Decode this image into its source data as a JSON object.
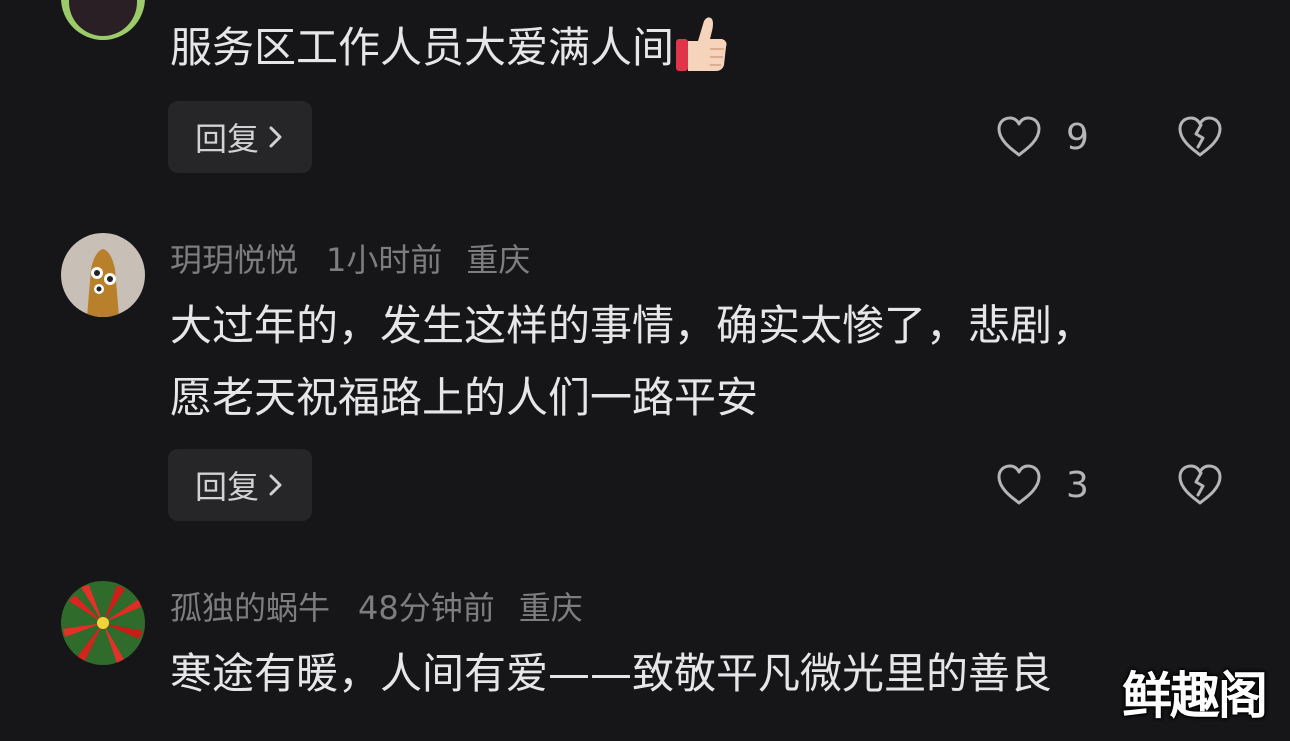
{
  "comments": [
    {
      "username": "",
      "time": "",
      "location": "",
      "text": "服务区工作人员大爱满人间",
      "emoji": "thumbs-up-icon",
      "reply_label": "回复",
      "likes": "9"
    },
    {
      "username": "玥玥悦悦",
      "time": "1小时前",
      "location": "重庆",
      "text_lines": [
        "大过年的，发生这样的事情，确实太惨了，悲剧，",
        "愿老天祝福路上的人们一路平安"
      ],
      "reply_label": "回复",
      "likes": "3"
    },
    {
      "username": "孤独的蜗牛",
      "time": "48分钟前",
      "location": "重庆",
      "text": "寒途有暖，人间有爱——致敬平凡微光里的善良"
    }
  ],
  "watermark": "鲜趣阁",
  "colors": {
    "background": "#161618",
    "text_primary": "#e6e6e8",
    "text_meta": "#7d7d80",
    "button_bg": "#262629"
  }
}
